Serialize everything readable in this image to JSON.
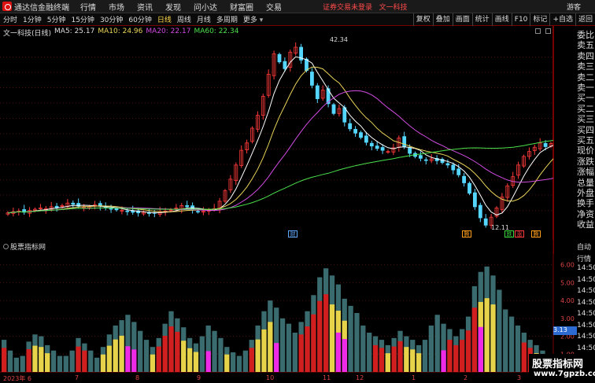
{
  "titlebar": {
    "app_title": "通达信金融终端",
    "menu": [
      "行情",
      "市场",
      "资讯",
      "发现",
      "问小达",
      "财富圈",
      "交易"
    ],
    "notice": "证券交易未登录",
    "stock": "文一科技",
    "guest": "游客"
  },
  "toolbar": {
    "periods": [
      "分时",
      "1分钟",
      "5分钟",
      "15分钟",
      "30分钟",
      "60分钟",
      "日线",
      "周线",
      "月线",
      "多周期",
      "更多"
    ],
    "active_period": "日线",
    "right_buttons": [
      "复权",
      "叠加",
      "画面",
      "统计",
      "画线",
      "F10",
      "标记",
      "+自选",
      "返回"
    ]
  },
  "main_chart": {
    "name": "文一科技(日线)",
    "ma5": "MA5: 25.17",
    "ma10": "MA10: 24.96",
    "ma20": "MA20: 22.17",
    "ma60": "MA60: 22.34",
    "high_label": "42.34",
    "low_label": "12.11",
    "events": [
      "财",
      "腾",
      "跌",
      "涨",
      "腾"
    ],
    "event_colors": [
      "#5fa8ff",
      "#ff9c1a",
      "#39d43c",
      "#ff3a3a",
      "#ff9c1a"
    ],
    "colors": {
      "up": "#ff3a3a",
      "down": "#54d6ff",
      "ma5": "#ffffff",
      "ma10": "#e8d45a",
      "ma20": "#d04be0",
      "ma60": "#4be04b"
    }
  },
  "chart_data": {
    "type": "candlestick",
    "yticks": [
      "40.00",
      "37.50",
      "35.00",
      "32.50",
      "30.00",
      "27.50",
      "25.00",
      "22.50",
      "20.00",
      "17.50",
      "15.00"
    ],
    "ylim": [
      12,
      42.5
    ],
    "close": [
      14.6,
      14.8,
      14.9,
      14.7,
      15.0,
      15.2,
      15.4,
      15.3,
      15.6,
      15.4,
      15.8,
      16.2,
      16.0,
      15.7,
      15.5,
      15.6,
      15.9,
      15.7,
      15.4,
      15.2,
      15.1,
      15.0,
      14.9,
      14.7,
      14.6,
      14.7,
      14.5,
      14.6,
      14.8,
      14.9,
      15.1,
      15.4,
      15.8,
      15.6,
      15.1,
      14.8,
      14.9,
      15.0,
      15.3,
      16.5,
      18.2,
      20.1,
      22.4,
      24.8,
      26.0,
      28.4,
      30.5,
      33.6,
      37.2,
      40.5,
      39.2,
      38.1,
      40.8,
      41.6,
      39.5,
      37.8,
      35.4,
      33.2,
      34.6,
      32.4,
      30.8,
      31.6,
      29.4,
      28.3,
      27.6,
      26.9,
      26.1,
      25.5,
      25.1,
      24.8,
      24.6,
      25.2,
      26.8,
      25.4,
      24.3,
      23.8,
      23.5,
      23.2,
      23.4,
      23.1,
      22.8,
      22.4,
      21.6,
      20.8,
      19.5,
      17.8,
      15.6,
      13.8,
      12.6,
      13.9,
      15.4,
      17.2,
      19.0,
      20.5,
      22.4,
      23.8,
      24.6,
      25.3,
      26.0,
      25.4,
      25.9,
      26.4,
      25.6,
      25.1
    ]
  },
  "sub_chart": {
    "title": "股票指标网",
    "yticks": [
      "6.00",
      "5.00",
      "4.00",
      "3.00",
      "2.00",
      "1.00"
    ],
    "current_value": "3.13",
    "dates": [
      "2023年 6",
      "7",
      "8",
      "9",
      "10",
      "11",
      "12",
      "1",
      "2",
      "3"
    ],
    "bars": [
      1.8,
      1.2,
      0.8,
      0.9,
      1.7,
      2.1,
      2.0,
      1.5,
      1.2,
      0.9,
      0.9,
      1.2,
      1.9,
      1.6,
      1.2,
      0.8,
      1.4,
      2.1,
      2.6,
      2.9,
      3.2,
      2.8,
      2.3,
      1.8,
      1.4,
      1.9,
      2.7,
      3.4,
      3.0,
      2.5,
      1.9,
      1.6,
      2.0,
      2.6,
      2.3,
      1.9,
      1.4,
      1.1,
      0.9,
      1.2,
      1.8,
      2.6,
      3.4,
      4.0,
      3.6,
      3.0,
      2.7,
      2.2,
      2.8,
      3.4,
      4.3,
      5.3,
      5.8,
      5.4,
      4.9,
      4.1,
      3.7,
      3.3,
      2.6,
      2.2,
      2.0,
      1.8,
      1.5,
      1.9,
      2.3,
      2.0,
      1.8,
      1.5,
      1.8,
      2.6,
      3.2,
      2.7,
      2.4,
      2.0,
      2.4,
      3.1,
      4.8,
      5.6,
      5.9,
      5.4,
      4.6,
      3.5,
      3.1,
      2.6,
      2.2,
      1.8,
      1.5,
      1.2,
      1.0
    ],
    "colors": {
      "teal": "#3a6b6e",
      "red": "#d11e1e",
      "yellow": "#e6d34a",
      "magenta": "#ee2ae7"
    }
  },
  "side_panel": {
    "labels": [
      "委比",
      "卖五",
      "卖四",
      "卖三",
      "卖二",
      "卖一",
      "买一",
      "买二",
      "买三",
      "买四",
      "买五",
      "现价",
      "涨跌",
      "涨幅",
      "总量",
      "外盘",
      "换手",
      "净资",
      "收益"
    ],
    "sub_labels": [
      "自动",
      "行情",
      "14:50",
      "14:50",
      "14:50",
      "14:50",
      "14:50",
      "14:50",
      "14:50",
      "14:50"
    ]
  },
  "watermark": {
    "title": "股票指标网",
    "url": "www.7gpzb.com"
  }
}
